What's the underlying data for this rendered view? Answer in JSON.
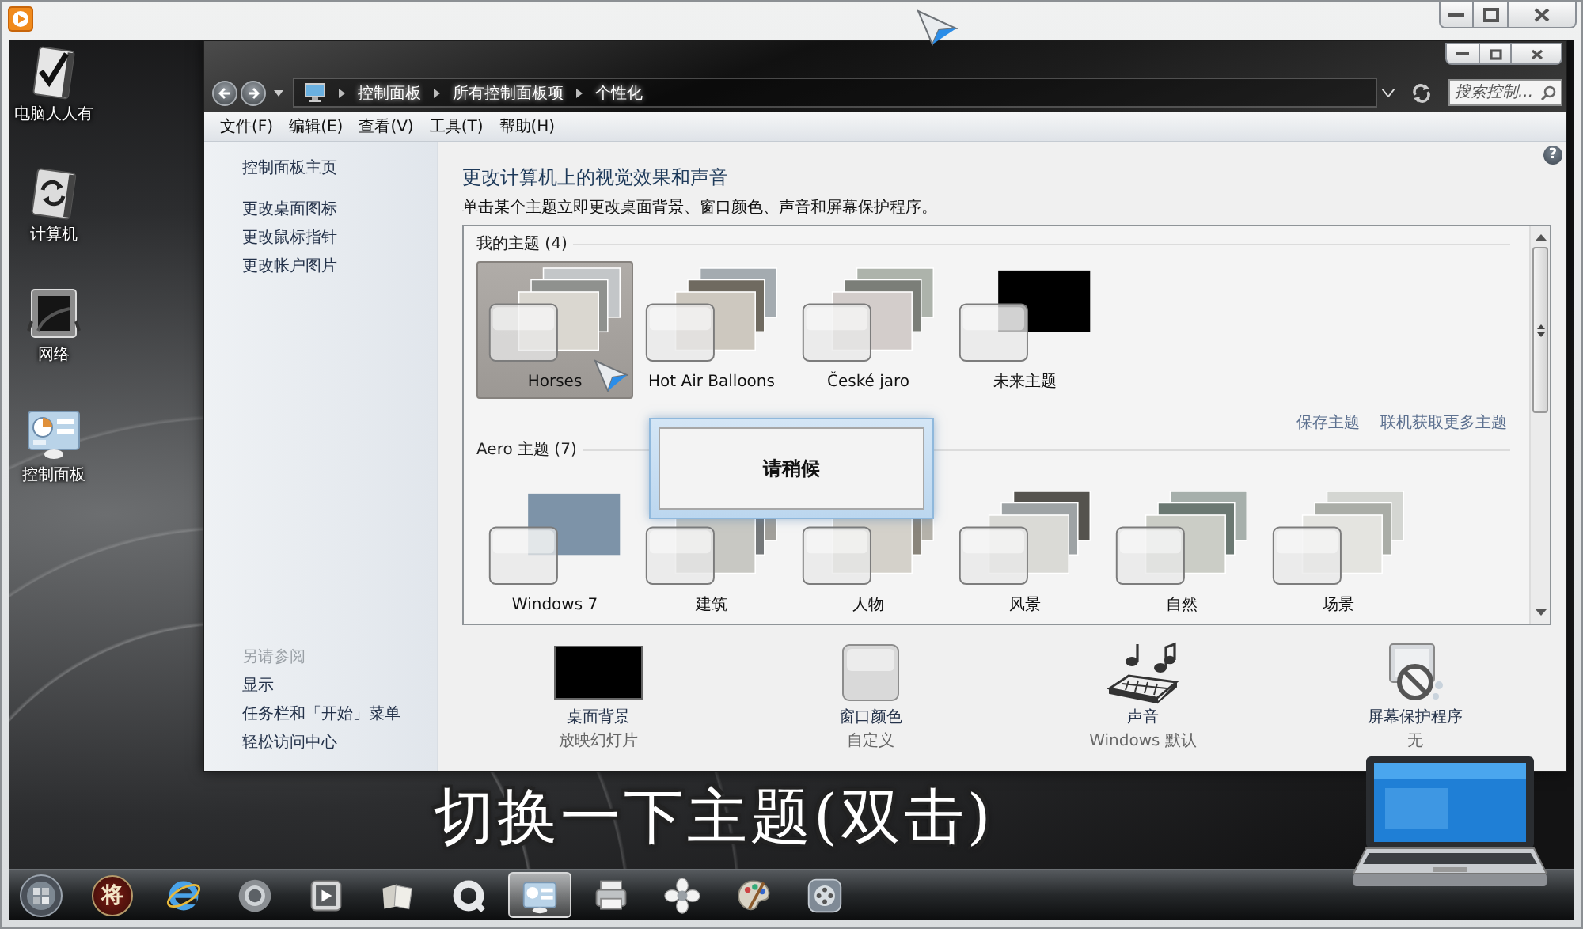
{
  "desktop_icons": [
    {
      "kind": "checkmark",
      "label": "电脑人人有"
    },
    {
      "kind": "refresh",
      "label": "计算机"
    },
    {
      "kind": "frame",
      "label": "网络"
    },
    {
      "kind": "panel",
      "label": "控制面板"
    }
  ],
  "explorer": {
    "breadcrumbs": [
      "控制面板",
      "所有控制面板项",
      "个性化"
    ],
    "search": {
      "placeholder": "搜索控制..."
    },
    "menu": [
      "文件(F)",
      "编辑(E)",
      "查看(V)",
      "工具(T)",
      "帮助(H)"
    ]
  },
  "sidebar": {
    "items": [
      "控制面板主页",
      "更改桌面图标",
      "更改鼠标指针",
      "更改帐户图片"
    ],
    "see_also": {
      "heading": "另请参阅",
      "items": [
        "显示",
        "任务栏和「开始」菜单",
        "轻松访问中心"
      ]
    }
  },
  "main": {
    "help": "?",
    "title": "更改计算机上的视觉效果和声音",
    "description": "单击某个主题立即更改桌面背景、窗口颜色、声音和屏幕保护程序。",
    "groups": [
      {
        "heading": "我的主题 (4)",
        "themes": [
          {
            "name": "Horses",
            "kind": "stack",
            "selected": true
          },
          {
            "name": "Hot Air Balloons",
            "kind": "stack",
            "selected": false
          },
          {
            "name": "České jaro",
            "kind": "stack",
            "selected": false
          },
          {
            "name": "未来主题",
            "kind": "single",
            "selected": false
          }
        ],
        "links": [
          "保存主题",
          "联机获取更多主题"
        ]
      },
      {
        "heading": "Aero 主题 (7)",
        "themes": [
          {
            "name": "Windows 7",
            "kind": "single",
            "selected": false
          },
          {
            "name": "建筑",
            "kind": "stack",
            "selected": false
          },
          {
            "name": "人物",
            "kind": "stack",
            "selected": false
          },
          {
            "name": "风景",
            "kind": "stack",
            "selected": false
          },
          {
            "name": "自然",
            "kind": "stack",
            "selected": false
          },
          {
            "name": "场景",
            "kind": "stack",
            "selected": false
          }
        ]
      }
    ],
    "dialog": {
      "message": "请稍候"
    },
    "settings": [
      {
        "kind": "background",
        "label": "桌面背景",
        "value": "放映幻灯片"
      },
      {
        "kind": "color",
        "label": "窗口颜色",
        "value": "自定义"
      },
      {
        "kind": "sound",
        "label": "声音",
        "value": "Windows 默认"
      },
      {
        "kind": "screensaver",
        "label": "屏幕保护程序",
        "value": "无"
      }
    ]
  },
  "caption": "切换一下主题(双击)",
  "taskbar": {
    "items": [
      {
        "kind": "start",
        "selected": false
      },
      {
        "kind": "glyph",
        "glyph": "将",
        "selected": false
      },
      {
        "kind": "browser-e",
        "selected": false
      },
      {
        "kind": "browser-ring",
        "selected": false
      },
      {
        "kind": "player",
        "selected": false
      },
      {
        "kind": "papers",
        "selected": false
      },
      {
        "kind": "ring",
        "selected": false
      },
      {
        "kind": "panel",
        "selected": true
      },
      {
        "kind": "printer",
        "selected": false
      },
      {
        "kind": "flower",
        "selected": false
      },
      {
        "kind": "palette",
        "selected": false
      },
      {
        "kind": "dial",
        "selected": false
      }
    ]
  }
}
